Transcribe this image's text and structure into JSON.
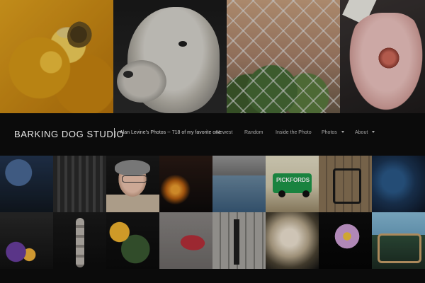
{
  "header": {
    "brand": "BARKING DOG STUDIO",
    "tagline": "Alan Levine's Photos -- 718 of my favorite one",
    "nav": [
      {
        "label": "Newest",
        "has_dropdown": false
      },
      {
        "label": "Random",
        "has_dropdown": false
      },
      {
        "label": "Inside the Photo",
        "has_dropdown": false
      },
      {
        "label": "Photos",
        "has_dropdown": true
      },
      {
        "label": "About",
        "has_dropdown": true
      }
    ]
  },
  "gallery": {
    "top_tiles": [
      {
        "label": "bee-on-sunflower"
      },
      {
        "label": "alpaca-closeup"
      },
      {
        "label": "succulents-behind-fence"
      },
      {
        "label": "hand-holding-object"
      }
    ],
    "grid_tiles": [
      {
        "label": "blue-bokeh"
      },
      {
        "label": "rope-textures"
      },
      {
        "label": "portrait-man-glasses"
      },
      {
        "label": "sunset-silhouette"
      },
      {
        "label": "lake-reflection"
      },
      {
        "label": "green-truck",
        "text": "PICKFORDS"
      },
      {
        "label": "wood-deck-wagon"
      },
      {
        "label": "blue-abstract"
      },
      {
        "label": "purple-flowers-and-yellow"
      },
      {
        "label": "stacked-stones"
      },
      {
        "label": "yellow-flower-leaves"
      },
      {
        "label": "red-petal"
      },
      {
        "label": "weathered-wood"
      },
      {
        "label": "dandelion-seedhead"
      },
      {
        "label": "lavender-flower"
      },
      {
        "label": "blue-sky-bench"
      }
    ]
  },
  "colors": {
    "background": "#0b0b0b",
    "text_primary": "#e8e8e8",
    "text_secondary": "#a8a8a8"
  }
}
